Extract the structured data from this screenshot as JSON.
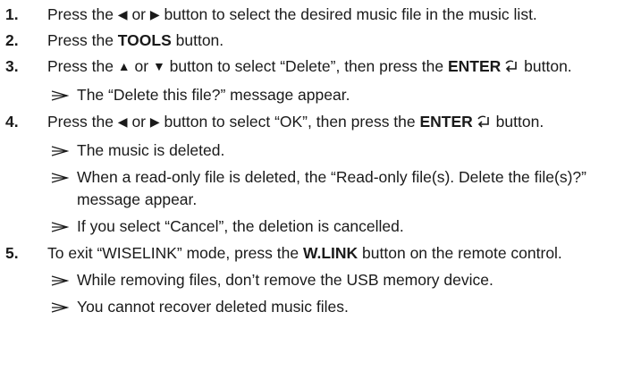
{
  "steps": [
    {
      "num": "1.",
      "parts": [
        {
          "t": "Press the "
        },
        {
          "icon": "left-triangle"
        },
        {
          "t": " or "
        },
        {
          "icon": "right-triangle"
        },
        {
          "t": " button to select the desired music file in the music list."
        }
      ],
      "notes": []
    },
    {
      "num": "2.",
      "parts": [
        {
          "t": "Press the "
        },
        {
          "t": "TOOLS",
          "b": true
        },
        {
          "t": " button."
        }
      ],
      "notes": []
    },
    {
      "num": "3.",
      "parts": [
        {
          "t": "Press the "
        },
        {
          "icon": "up-triangle"
        },
        {
          "t": " or "
        },
        {
          "icon": "down-triangle"
        },
        {
          "t": " button to select “Delete”, then press the "
        },
        {
          "t": "ENTER",
          "b": true
        },
        {
          "icon": "enter"
        },
        {
          "t": " button."
        }
      ],
      "notes": [
        "The “Delete this file?” message appear."
      ]
    },
    {
      "num": "4.",
      "parts": [
        {
          "t": "Press the "
        },
        {
          "icon": "left-triangle"
        },
        {
          "t": " or "
        },
        {
          "icon": "right-triangle"
        },
        {
          "t": " button to select “OK”, then press the "
        },
        {
          "t": "ENTER",
          "b": true
        },
        {
          "icon": "enter"
        },
        {
          "t": " button."
        }
      ],
      "notes": [
        "The music is deleted.",
        "When a read-only file is deleted, the “Read-only file(s). Delete the file(s)?” message appear.",
        "If you select “Cancel”, the deletion is cancelled."
      ]
    },
    {
      "num": "5.",
      "parts": [
        {
          "t": "To exit “WISELINK” mode, press the "
        },
        {
          "t": "W.LINK",
          "b": true
        },
        {
          "t": " button on the remote control."
        }
      ],
      "notes": [
        "While removing files, don’t remove the USB memory device.",
        "You cannot recover deleted music files."
      ]
    }
  ],
  "colors": {
    "text": "#1a1a1a",
    "background": "#ffffff"
  }
}
